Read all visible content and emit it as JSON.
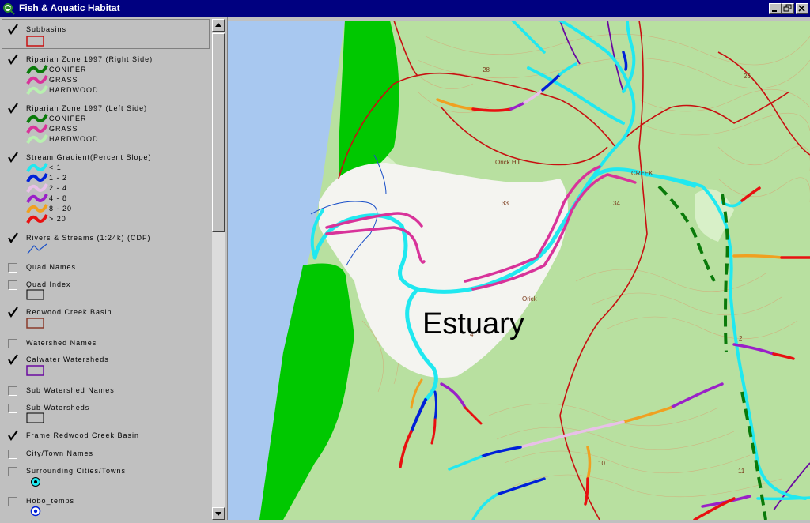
{
  "window": {
    "title": "Fish & Aquatic Habitat"
  },
  "legend": {
    "subbasins": {
      "label": "Subbasins",
      "checked": true
    },
    "riparian_right": {
      "label": "Riparian Zone 1997 (Right Side)",
      "checked": true,
      "classes": [
        "CONIFER",
        "GRASS",
        "HARDWOOD"
      ]
    },
    "riparian_left": {
      "label": "Riparian Zone 1997 (Left Side)",
      "checked": true,
      "classes": [
        "CONIFER",
        "GRASS",
        "HARDWOOD"
      ]
    },
    "stream_gradient": {
      "label": "Stream Gradient(Percent Slope)",
      "checked": true,
      "classes": [
        "< 1",
        "1 - 2",
        "2 - 4",
        "4 - 8",
        "8 - 20",
        "> 20"
      ]
    },
    "rivers_streams": {
      "label": "Rivers & Streams (1:24k) (CDF)",
      "checked": true
    },
    "quad_names": {
      "label": "Quad Names",
      "checked": false
    },
    "quad_index": {
      "label": "Quad Index",
      "checked": false
    },
    "redwood_creek_basin": {
      "label": "Redwood Creek Basin",
      "checked": true
    },
    "watershed_names": {
      "label": "Watershed Names",
      "checked": false
    },
    "calwater_watersheds": {
      "label": "Calwater Watersheds",
      "checked": true
    },
    "sub_watershed_names": {
      "label": "Sub Watershed Names",
      "checked": false
    },
    "sub_watersheds": {
      "label": "Sub Watersheds",
      "checked": false
    },
    "frame_redwood_creek_basin": {
      "label": "Frame Redwood Creek Basin",
      "checked": true
    },
    "city_town_names": {
      "label": "City/Town Names",
      "checked": false
    },
    "surrounding_cities": {
      "label": "Surrounding Cities/Towns",
      "checked": false
    },
    "hobo_temps": {
      "label": "Hobo_temps",
      "checked": false
    }
  },
  "colors": {
    "conifer": "#0a7a0a",
    "grass": "#d8339a",
    "hardwood": "#b8f0b0",
    "gradient_lt1": "#20e8f0",
    "gradient_1_2": "#0020d8",
    "gradient_2_4": "#e8c0e8",
    "gradient_4_8": "#9a20c8",
    "gradient_8_20": "#f0a020",
    "gradient_gt20": "#e81010",
    "ocean": "#a8c8f0",
    "beach_green": "#00c800",
    "terrain": "#b8e0a0",
    "clearing": "#f4f4f0",
    "subbasin_line": "#c81010",
    "calwater_line": "#6a0aa0"
  },
  "map": {
    "area_label": "Estuary",
    "labels": [
      "28",
      "26",
      "33",
      "34",
      "10",
      "11",
      "2",
      "4",
      "Orick",
      "Orick Hill",
      "CREEK"
    ]
  }
}
